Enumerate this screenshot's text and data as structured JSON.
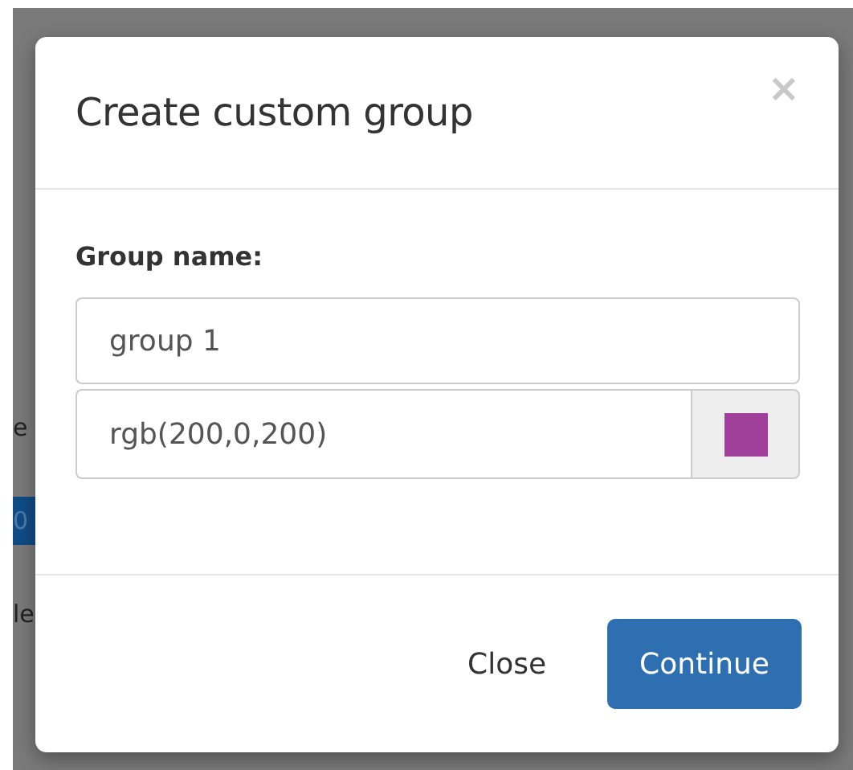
{
  "background": {
    "fragments": [
      {
        "text": "e",
        "kind": "plain"
      },
      {
        "text": "0",
        "kind": "highlight"
      },
      {
        "text": "le",
        "kind": "plain"
      }
    ]
  },
  "dialog": {
    "title": "Create custom group",
    "close_icon": "×",
    "label": "Group name:",
    "name_field": {
      "value": "group 1"
    },
    "color_field": {
      "value": "rgb(200,0,200)",
      "color": "#a0409a"
    },
    "buttons": [
      {
        "label": "Close",
        "kind": "secondary"
      },
      {
        "label": "Continue",
        "kind": "primary"
      }
    ]
  }
}
